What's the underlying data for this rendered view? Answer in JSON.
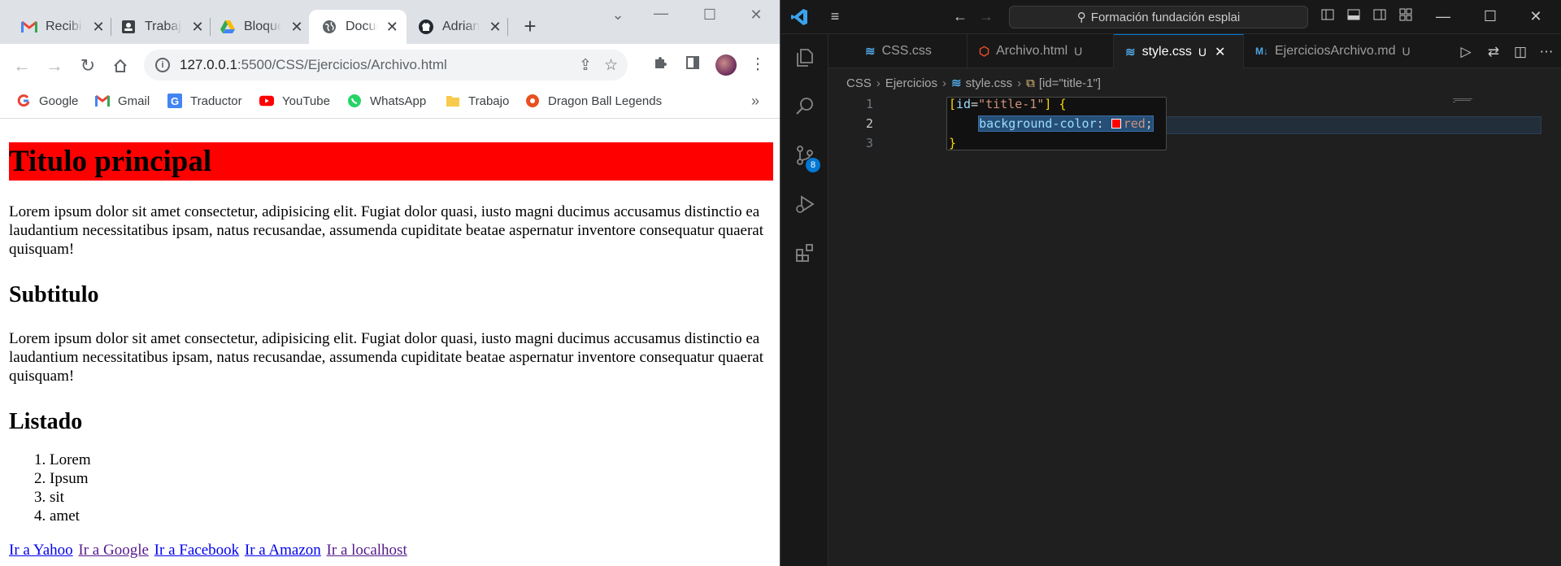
{
  "browser": {
    "tabs": [
      {
        "title": "Recibidos",
        "icon": "gmail-icon"
      },
      {
        "title": "Trabajo",
        "icon": "contacts-icon"
      },
      {
        "title": "Bloque",
        "icon": "drive-icon"
      },
      {
        "title": "Documento",
        "icon": "globe-icon",
        "active": true
      },
      {
        "title": "Adrian",
        "icon": "github-icon"
      }
    ],
    "url_host": "127.0.0.1",
    "url_path": ":5500/CSS/Ejercicios/Archivo.html",
    "bookmarks": [
      "Google",
      "Gmail",
      "Traductor",
      "YouTube",
      "WhatsApp",
      "Trabajo",
      "Dragon Ball Legends"
    ],
    "bookmarks_more": "»"
  },
  "page": {
    "title": "Titulo principal",
    "paragraph1": "Lorem ipsum dolor sit amet consectetur, adipisicing elit. Fugiat dolor quasi, iusto magni ducimus accusamus distinctio ea laudantium necessitatibus ipsam, natus recusandae, assumenda cupiditate beatae aspernatur inventore consequatur quaerat quisquam!",
    "subtitle": "Subtitulo",
    "paragraph2": "Lorem ipsum dolor sit amet consectetur, adipisicing elit. Fugiat dolor quasi, iusto magni ducimus accusamus distinctio ea laudantium necessitatibus ipsam, natus recusandae, assumenda cupiditate beatae aspernatur inventore consequatur quaerat quisquam!",
    "list_heading": "Listado",
    "list_items": [
      "Lorem",
      "Ipsum",
      "sit",
      "amet"
    ],
    "links": [
      "Ir a Yahoo",
      "Ir a Google",
      "Ir a Facebook",
      "Ir a Amazon",
      "Ir a localhost"
    ],
    "title_bg_color": "#ff0000"
  },
  "vscode": {
    "command_center": "Formación fundación esplai",
    "scm_badge": "8",
    "tabs": [
      {
        "label": "CSS.css",
        "icon": "css-icon",
        "modified": ""
      },
      {
        "label": "Archivo.html",
        "icon": "html-icon",
        "modified": "U"
      },
      {
        "label": "style.css",
        "icon": "css-icon",
        "modified": "U",
        "active": true
      },
      {
        "label": "EjerciciosArchivo.md",
        "icon": "markdown-icon",
        "modified": "U"
      }
    ],
    "breadcrumbs": [
      "CSS",
      "Ejercicios",
      "style.css",
      "[id=\"title-1\"]"
    ],
    "line_numbers": [
      "1",
      "2",
      "3"
    ],
    "code": {
      "line1_attr": "id",
      "line1_value": "\"title-1\"",
      "line2_prop": "background-color",
      "line2_value": "red"
    }
  }
}
